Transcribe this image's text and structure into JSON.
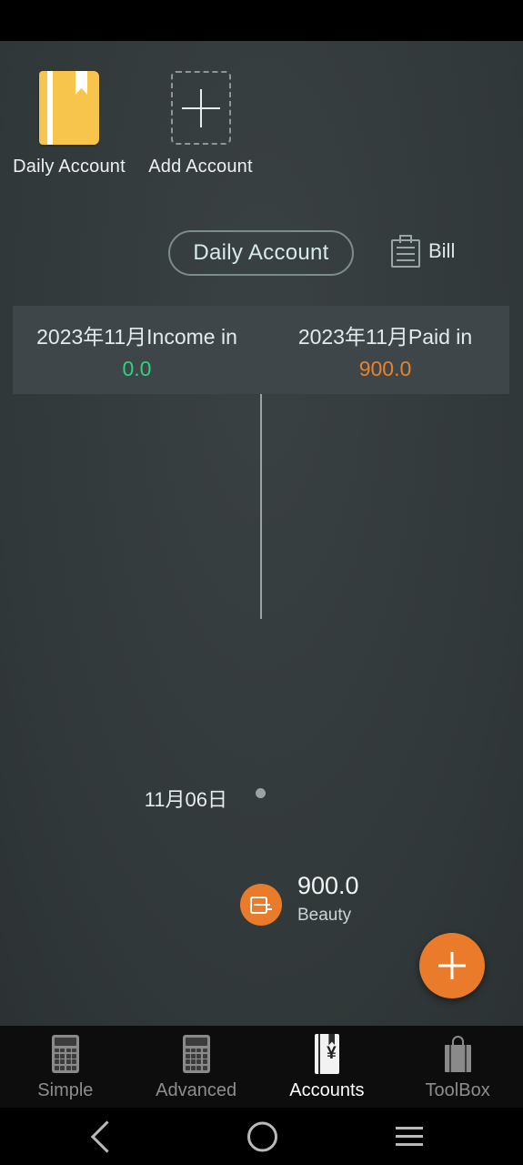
{
  "app": {
    "shortcuts": [
      {
        "label": "Daily Account",
        "icon": "account-book-icon"
      },
      {
        "label": "Add Account",
        "icon": "plus-icon"
      }
    ],
    "tabs": {
      "active_pill": "Daily Account",
      "bill_label": "Bill",
      "bill_icon": "clipboard-icon"
    },
    "summary": {
      "income": {
        "title": "2023年11月Income in",
        "value": "0.0",
        "color": "#2fd27f"
      },
      "paid": {
        "title": "2023年11月Paid in",
        "value": "900.0",
        "color": "#e8822c"
      }
    },
    "timeline": {
      "date": "11月06日",
      "entries": [
        {
          "amount": "900.0",
          "category": "Beauty",
          "icon": "beauty-icon",
          "color": "#ea7b2a"
        }
      ]
    },
    "fab": {
      "icon": "plus-icon",
      "color": "#ea7b2a"
    }
  },
  "bottom_nav": [
    {
      "label": "Simple",
      "icon": "calculator-icon",
      "active": false
    },
    {
      "label": "Advanced",
      "icon": "calculator-icon",
      "active": false
    },
    {
      "label": "Accounts",
      "icon": "account-book-yen-icon",
      "active": true
    },
    {
      "label": "ToolBox",
      "icon": "toolbox-icon",
      "active": false
    }
  ],
  "system_nav": [
    {
      "name": "back",
      "icon": "chevron-left-icon"
    },
    {
      "name": "home",
      "icon": "circle-icon"
    },
    {
      "name": "recents",
      "icon": "hamburger-icon"
    }
  ],
  "yen_symbol": "¥"
}
